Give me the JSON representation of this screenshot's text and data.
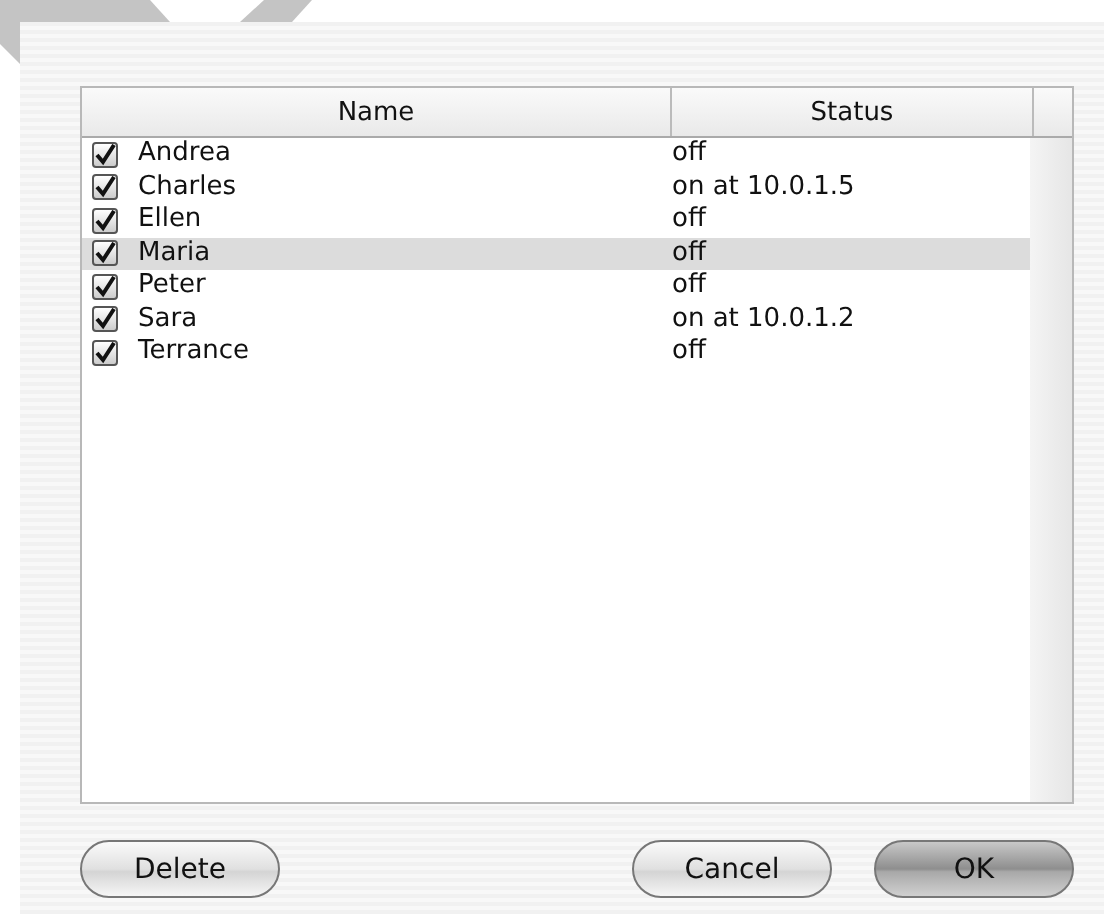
{
  "table": {
    "columns": [
      "Name",
      "Status"
    ],
    "rows": [
      {
        "name": "Andrea",
        "status": "off",
        "checked": true,
        "selected": false
      },
      {
        "name": "Charles",
        "status": "on at 10.0.1.5",
        "checked": true,
        "selected": false
      },
      {
        "name": "Ellen",
        "status": "off",
        "checked": true,
        "selected": false
      },
      {
        "name": "Maria",
        "status": "off",
        "checked": true,
        "selected": true
      },
      {
        "name": "Peter",
        "status": "off",
        "checked": true,
        "selected": false
      },
      {
        "name": "Sara",
        "status": "on at 10.0.1.2",
        "checked": true,
        "selected": false
      },
      {
        "name": "Terrance",
        "status": "off",
        "checked": true,
        "selected": false
      }
    ]
  },
  "buttons": [
    {
      "label": "Delete",
      "kind": "left",
      "default": false
    },
    {
      "label": "Cancel",
      "kind": "right",
      "default": false
    },
    {
      "label": "OK",
      "kind": "right",
      "default": true
    }
  ]
}
